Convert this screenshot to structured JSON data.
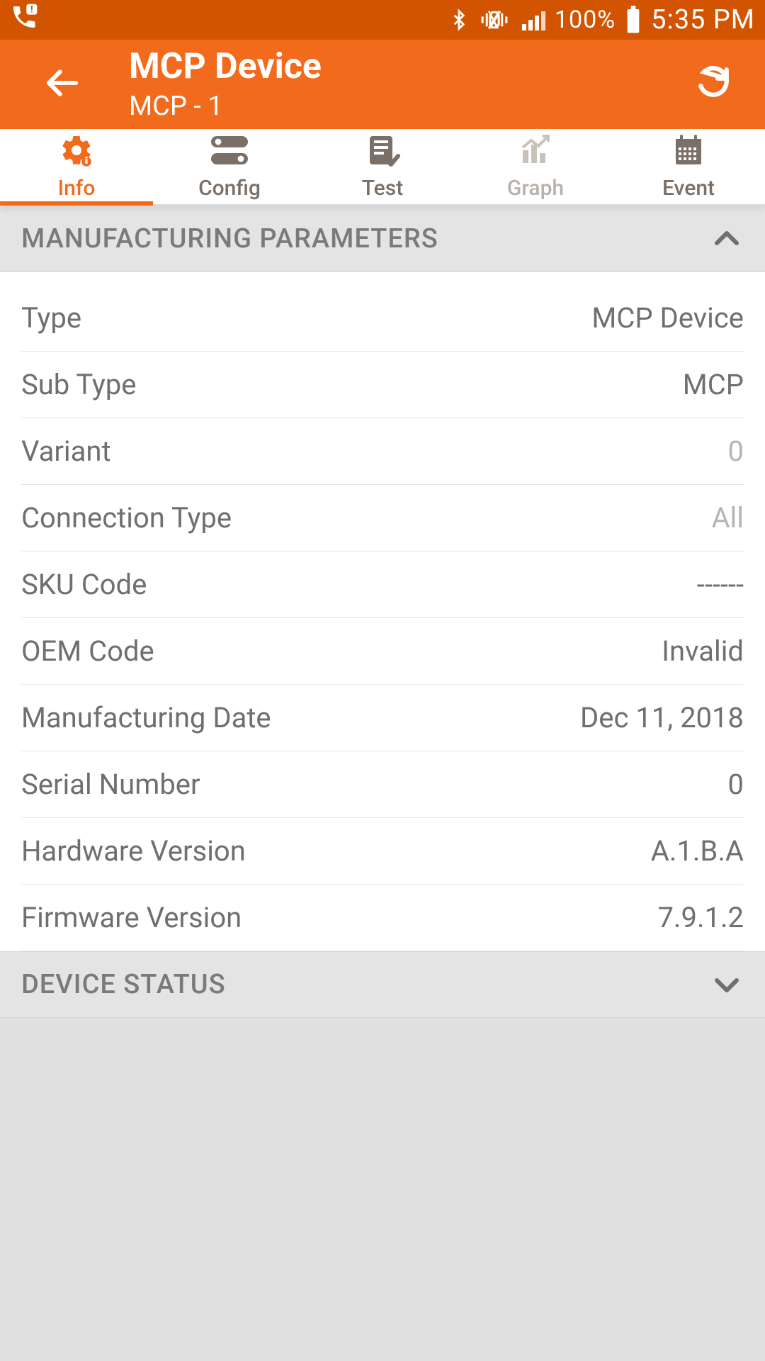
{
  "status": {
    "battery": "100%",
    "time": "5:35 PM"
  },
  "header": {
    "title": "MCP Device",
    "subtitle": "MCP - 1"
  },
  "tabs": [
    {
      "label": "Info",
      "icon": "gear-info-icon",
      "state": "active"
    },
    {
      "label": "Config",
      "icon": "toggles-icon",
      "state": "normal"
    },
    {
      "label": "Test",
      "icon": "checklist-icon",
      "state": "normal"
    },
    {
      "label": "Graph",
      "icon": "chart-icon",
      "state": "faded"
    },
    {
      "label": "Event",
      "icon": "calendar-icon",
      "state": "normal"
    }
  ],
  "sections": {
    "manufacturing": {
      "title": "MANUFACTURING PARAMETERS",
      "expanded": true,
      "rows": [
        {
          "label": "Type",
          "value": "MCP Device",
          "light": false
        },
        {
          "label": "Sub Type",
          "value": "MCP",
          "light": false
        },
        {
          "label": "Variant",
          "value": "0",
          "light": true
        },
        {
          "label": "Connection Type",
          "value": "All",
          "light": true
        },
        {
          "label": "SKU Code",
          "value": "------",
          "light": false
        },
        {
          "label": "OEM Code",
          "value": "Invalid",
          "light": false
        },
        {
          "label": "Manufacturing Date",
          "value": "Dec 11, 2018",
          "light": false
        },
        {
          "label": "Serial Number",
          "value": "0",
          "light": false
        },
        {
          "label": "Hardware Version",
          "value": "A.1.B.A",
          "light": false
        },
        {
          "label": "Firmware Version",
          "value": "7.9.1.2",
          "light": false
        }
      ]
    },
    "device_status": {
      "title": "DEVICE STATUS",
      "expanded": false
    }
  }
}
